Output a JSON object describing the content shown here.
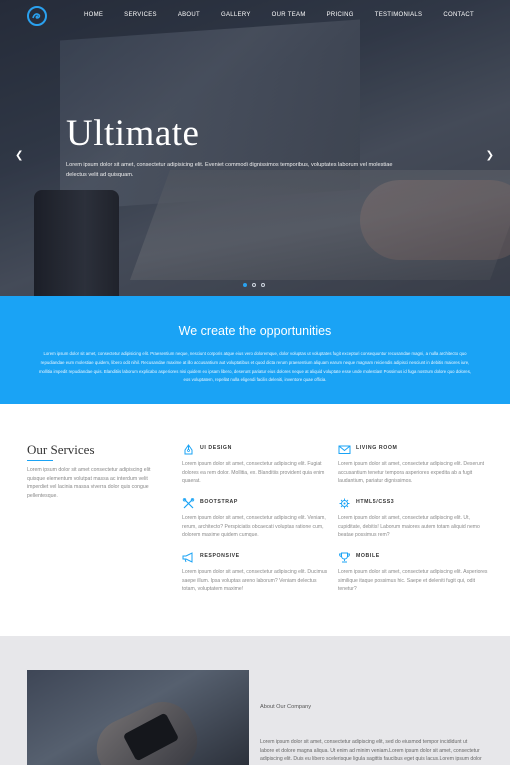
{
  "header": {
    "logo": "logo-wave-icon",
    "nav": [
      "HOME",
      "SERVICES",
      "ABOUT",
      "GALLERY",
      "OUR TEAM",
      "PRICING",
      "TESTIMONIALS",
      "CONTACT"
    ]
  },
  "hero": {
    "title": "Ultimate",
    "subtitle": "Lorem ipsum dolor sit amet, consectetur adipisicing elit. Eveniet commodi dignissimos temporibus, voluptates laborum vel molestiae delectus velit ad quisquam.",
    "prev_icon": "chevron-left-icon",
    "next_icon": "chevron-right-icon",
    "slides": 3,
    "active_slide": 1
  },
  "band": {
    "title": "We create the opportunities",
    "text": "Lorem ipsum dolor sit amet, consectetur adipisicing elit. Praesentium neque, nesciunt corporis atque eius vero doloremque, dolor voluptas ut voluptates fugit excepturi consequuntur recusandae magni, a nulla architecto quo repudiandae eum molestiae quidem, libero odit nihil. Recusandae maxime at illo accusantium aut voluptatibus et quod dicta rerum praesentium aliquam earum neque magnam reiciendis adipisci nesciunt in debitis maiores iure, mollitia impedit repudiandae quis. Blanditiis laborum explicabo asperiores nisi quidem ex ipsam libero, deserunt pariatur eius dolores neque at aliquid voluptate esse unde molestias! Possimus id fuga nostrum dolore quo dolores, eos voluptatem, repellat nulla eligendi facilis deleniti, inventore quae officia."
  },
  "services": {
    "title": "Our Services",
    "intro": "Lorem ipsum dolor sit amet consectetur adipiscing elit quisque elementum volutpat massa ac interdum velit imperdiet vel lacinia massa viverra dolor quis congue pellentesque.",
    "items": [
      {
        "name": "UI DESIGN",
        "icon": "pen-tool-icon",
        "text": "Lorem ipsum dolor sit amet, consectetur adipiscing elit. Fugiat dolores ea rem dolor. Mollitia, ex. Blanditiis provident quia enim quaerat."
      },
      {
        "name": "LIVING ROOM",
        "icon": "envelope-icon",
        "text": "Lorem ipsum dolor sit amet, consectetur adipiscing elit. Deserunt accusantium tenetur tempora asperiores expedita ab a fugit laudantium, pariatur dignissimos."
      },
      {
        "name": "BOOTSTRAP",
        "icon": "tools-icon",
        "text": "Lorem ipsum dolor sit amet, consectetur adipiscing elit. Veniam, rerum, architecto? Perspiciatis obcaecati voluptas ratione cum, dolorem maxime quidem cumque."
      },
      {
        "name": "HTML5/CSS3",
        "icon": "gear-icon",
        "text": "Lorem ipsum dolor sit amet, consectetur adipiscing elit. Ut, cupiditate, debitis! Laborum maiores autem totam aliquid nemo beatae possimus rem?"
      },
      {
        "name": "RESPONSIVE",
        "icon": "megaphone-icon",
        "text": "Lorem ipsum dolor sit amet, consectetur adipiscing elit. Ducimus saepe illum. Ipsa voluptas areno laborum? Veniam delectus totam, voluptatem maxime!"
      },
      {
        "name": "MOBILE",
        "icon": "trophy-icon",
        "text": "Lorem ipsum dolor sit amet, consectetur adipiscing elit. Asperiores similique itaque possimus hic. Saepe et deleniti fugit qui, odit tenetur?"
      }
    ]
  },
  "about": {
    "label": "About Our Company",
    "text": "Lorem ipsum dolor sit amet, consectetur adipiscing elit, sed do eiusmod tempor incididunt ut labore et dolore magna aliqua. Ut enim ad minim veniam.Lorem ipsum dolor sit amet, consectetur adipiscing elit. Duis eu libero scelerisque ligula sagittis faucibus eget quis lacus.Lorem ipsum dolor sit amet, consectetur adipiscing elit.Lorem"
  },
  "colors": {
    "accent": "#1aa3f5",
    "band": "#1aa3f5",
    "about_bg": "#e7e7ea"
  }
}
